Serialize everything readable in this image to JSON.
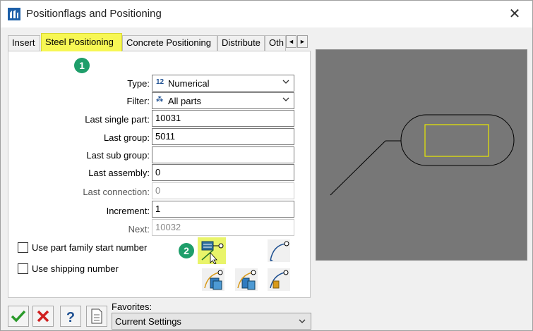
{
  "window": {
    "title": "Positionflags and Positioning",
    "close_glyph": "✕"
  },
  "tabs": [
    {
      "label": "Insert",
      "active": false
    },
    {
      "label": "Steel Positioning",
      "active": true
    },
    {
      "label": "Concrete Positioning",
      "active": false
    },
    {
      "label": "Distribute",
      "active": false
    },
    {
      "label": "Oth",
      "active": false
    }
  ],
  "tab_scroll": {
    "left": "◄",
    "right": "►"
  },
  "badges": {
    "one": "1",
    "two": "2"
  },
  "form": {
    "type": {
      "label": "Type:",
      "icon": "12",
      "value": "Numerical"
    },
    "filter": {
      "label": "Filter:",
      "icon": "⁂",
      "value": "All parts"
    },
    "last_single_part": {
      "label": "Last single part:",
      "value": "10031"
    },
    "last_group": {
      "label": "Last group:",
      "value": "5011"
    },
    "last_sub_group": {
      "label": "Last sub group:",
      "value": ""
    },
    "last_assembly": {
      "label": "Last assembly:",
      "value": "0"
    },
    "last_connection": {
      "label": "Last connection:",
      "value": "0"
    },
    "increment": {
      "label": "Increment:",
      "value": "1"
    },
    "next": {
      "label": "Next:",
      "value": "10032"
    }
  },
  "checkboxes": {
    "part_family": {
      "label": "Use part family start number",
      "checked": false
    },
    "shipping": {
      "label": "Use shipping number",
      "checked": false
    }
  },
  "favorites": {
    "label": "Favorites:",
    "value": "Current Settings"
  },
  "colors": {
    "active_tab": "#f7f754",
    "highlight": "#e9f46a",
    "badge": "#1e9e6a",
    "preview_bg": "#777777",
    "preview_rect": "#e8e800"
  }
}
